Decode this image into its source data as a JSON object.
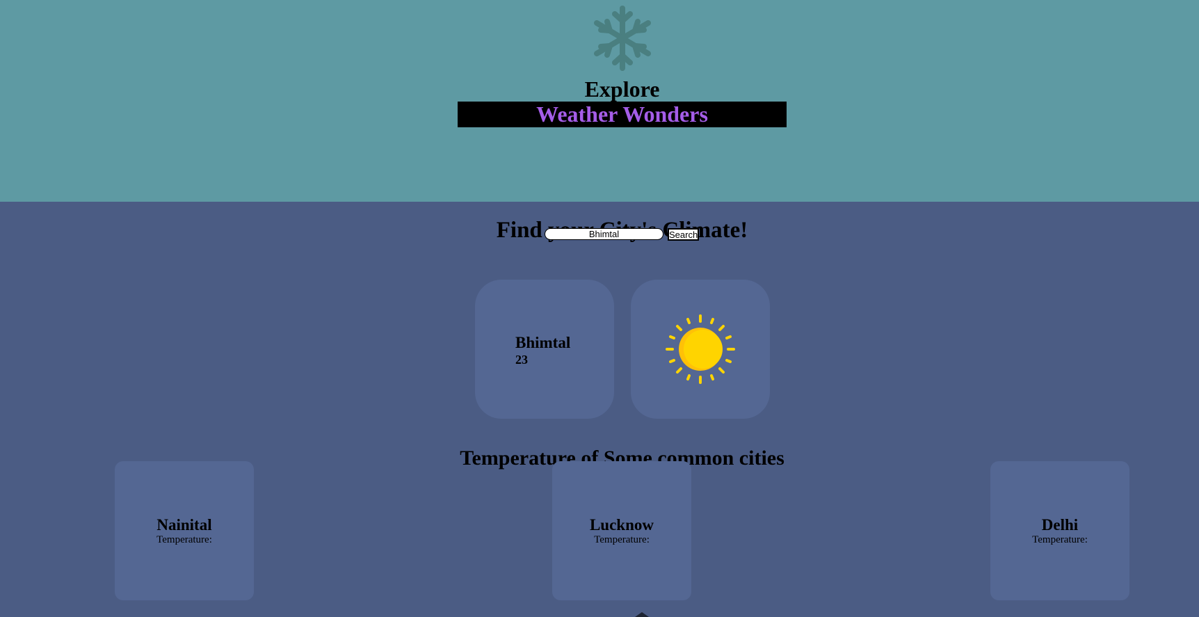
{
  "header": {
    "icon": "snowflake-icon",
    "eyebrow": "Explore",
    "brand": "Weather Wonders"
  },
  "search": {
    "title": "Find your City's Climate!",
    "value": "Bhimtal",
    "button_label": "Search"
  },
  "current_weather": {
    "city": "Bhimtal",
    "temperature": "23",
    "icon": "sun-icon"
  },
  "common_cities": {
    "title": "Temperature of Some common cities",
    "items": [
      {
        "city": "Nainital",
        "temperature_label": "Temperature:"
      },
      {
        "city": "Lucknow",
        "temperature_label": "Temperature:"
      },
      {
        "city": "Delhi",
        "temperature_label": "Temperature:"
      }
    ]
  },
  "colors": {
    "hero_background": "#5e9aa3",
    "page_background": "#4b5c84",
    "card_background": "#546793",
    "brand_text": "#a55de8",
    "sun": "#ffd400"
  }
}
